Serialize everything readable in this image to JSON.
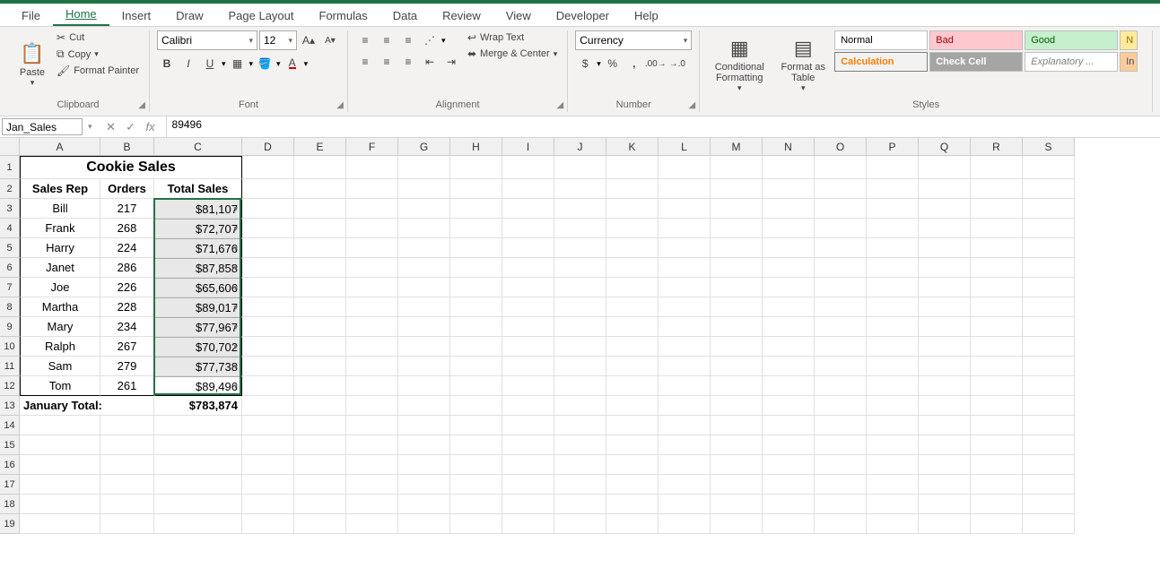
{
  "menubar": {
    "items": [
      "File",
      "Home",
      "Insert",
      "Draw",
      "Page Layout",
      "Formulas",
      "Data",
      "Review",
      "View",
      "Developer",
      "Help"
    ],
    "active": "Home"
  },
  "ribbon": {
    "clipboard": {
      "label": "Clipboard",
      "paste": "Paste",
      "cut": "Cut",
      "copy": "Copy",
      "format_painter": "Format Painter"
    },
    "font": {
      "label": "Font",
      "name": "Calibri",
      "size": "12",
      "bold": "B",
      "italic": "I",
      "underline": "U"
    },
    "alignment": {
      "label": "Alignment",
      "wrap": "Wrap Text",
      "merge": "Merge & Center"
    },
    "number": {
      "label": "Number",
      "format": "Currency"
    },
    "styles": {
      "label": "Styles",
      "cond": "Conditional Formatting",
      "table": "Format as Table",
      "cells": {
        "normal": "Normal",
        "bad": "Bad",
        "good": "Good",
        "calc": "Calculation",
        "check": "Check Cell",
        "explan": "Explanatory ...",
        "n": "N",
        "i": "In"
      }
    }
  },
  "formula_bar": {
    "name": "Jan_Sales",
    "formula": "89496"
  },
  "columns": [
    "A",
    "B",
    "C",
    "D",
    "E",
    "F",
    "G",
    "H",
    "I",
    "J",
    "K",
    "L",
    "M",
    "N",
    "O",
    "P",
    "Q",
    "R",
    "S"
  ],
  "rows": [
    1,
    2,
    3,
    4,
    5,
    6,
    7,
    8,
    9,
    10,
    11,
    12,
    13,
    14,
    15,
    16,
    17,
    18,
    19
  ],
  "sheet": {
    "title": "Cookie Sales",
    "headers": {
      "rep": "Sales Rep",
      "orders": "Orders",
      "total": "Total Sales"
    },
    "data": [
      {
        "rep": "Bill",
        "orders": "217",
        "total": "$81,107"
      },
      {
        "rep": "Frank",
        "orders": "268",
        "total": "$72,707"
      },
      {
        "rep": "Harry",
        "orders": "224",
        "total": "$71,676"
      },
      {
        "rep": "Janet",
        "orders": "286",
        "total": "$87,858"
      },
      {
        "rep": "Joe",
        "orders": "226",
        "total": "$65,606"
      },
      {
        "rep": "Martha",
        "orders": "228",
        "total": "$89,017"
      },
      {
        "rep": "Mary",
        "orders": "234",
        "total": "$77,967"
      },
      {
        "rep": "Ralph",
        "orders": "267",
        "total": "$70,702"
      },
      {
        "rep": "Sam",
        "orders": "279",
        "total": "$77,738"
      },
      {
        "rep": "Tom",
        "orders": "261",
        "total": "$89,496"
      }
    ],
    "footer": {
      "label": "January Total:",
      "value": "$783,874"
    }
  }
}
